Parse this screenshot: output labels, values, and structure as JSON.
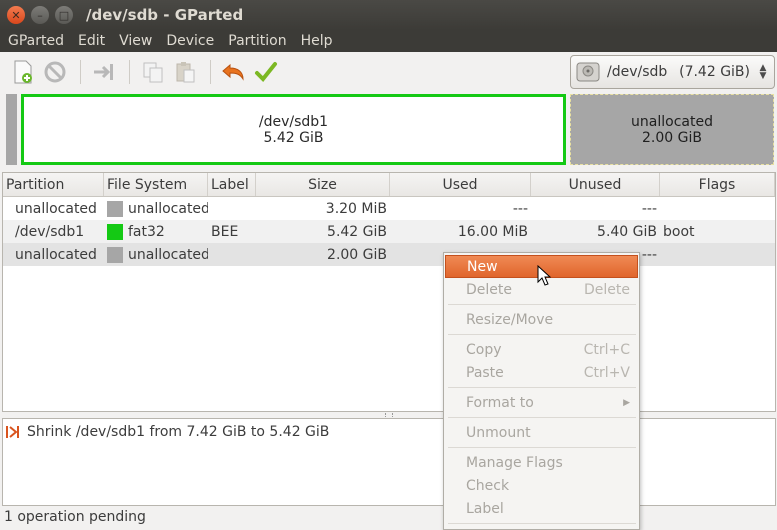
{
  "window": {
    "title": "/dev/sdb - GParted"
  },
  "menubar": [
    "GParted",
    "Edit",
    "View",
    "Device",
    "Partition",
    "Help"
  ],
  "toolbar": {
    "buttons": [
      "new-icon",
      "delete-icon",
      "resize-move-icon",
      "copy-icon",
      "paste-icon",
      "undo-icon",
      "apply-icon"
    ]
  },
  "device_selector": {
    "device": "/dev/sdb",
    "size": "(7.42 GiB)"
  },
  "disk_map": {
    "sdb1": {
      "name": "/dev/sdb1",
      "size": "5.42 GiB",
      "color": "#14c914"
    },
    "unallocated": {
      "name": "unallocated",
      "size": "2.00 GiB",
      "color": "#a6a6a6"
    }
  },
  "table": {
    "headers": [
      "Partition",
      "File System",
      "Label",
      "Size",
      "Used",
      "Unused",
      "Flags"
    ],
    "rows": [
      {
        "partition": "unallocated",
        "fs": "unallocated",
        "fs_color": "#a6a6a6",
        "label": "",
        "size": "3.20 MiB",
        "used": "---",
        "unused": "---",
        "flags": ""
      },
      {
        "partition": "/dev/sdb1",
        "fs": "fat32",
        "fs_color": "#14c914",
        "label": "BEE",
        "size": "5.42 GiB",
        "used": "16.00 MiB",
        "unused": "5.40 GiB",
        "flags": "boot"
      },
      {
        "partition": "unallocated",
        "fs": "unallocated",
        "fs_color": "#a6a6a6",
        "label": "",
        "size": "2.00 GiB",
        "used": "",
        "unused": "---",
        "flags": ""
      }
    ]
  },
  "operations": [
    "Shrink /dev/sdb1 from 7.42 GiB to 5.42 GiB"
  ],
  "status": "1 operation pending",
  "context_menu": {
    "new": "New",
    "delete": "Delete",
    "delete_acc": "Delete",
    "resize": "Resize/Move",
    "copy": "Copy",
    "copy_acc": "Ctrl+C",
    "paste": "Paste",
    "paste_acc": "Ctrl+V",
    "format": "Format to",
    "unmount": "Unmount",
    "flags": "Manage Flags",
    "check": "Check",
    "label": "Label"
  }
}
